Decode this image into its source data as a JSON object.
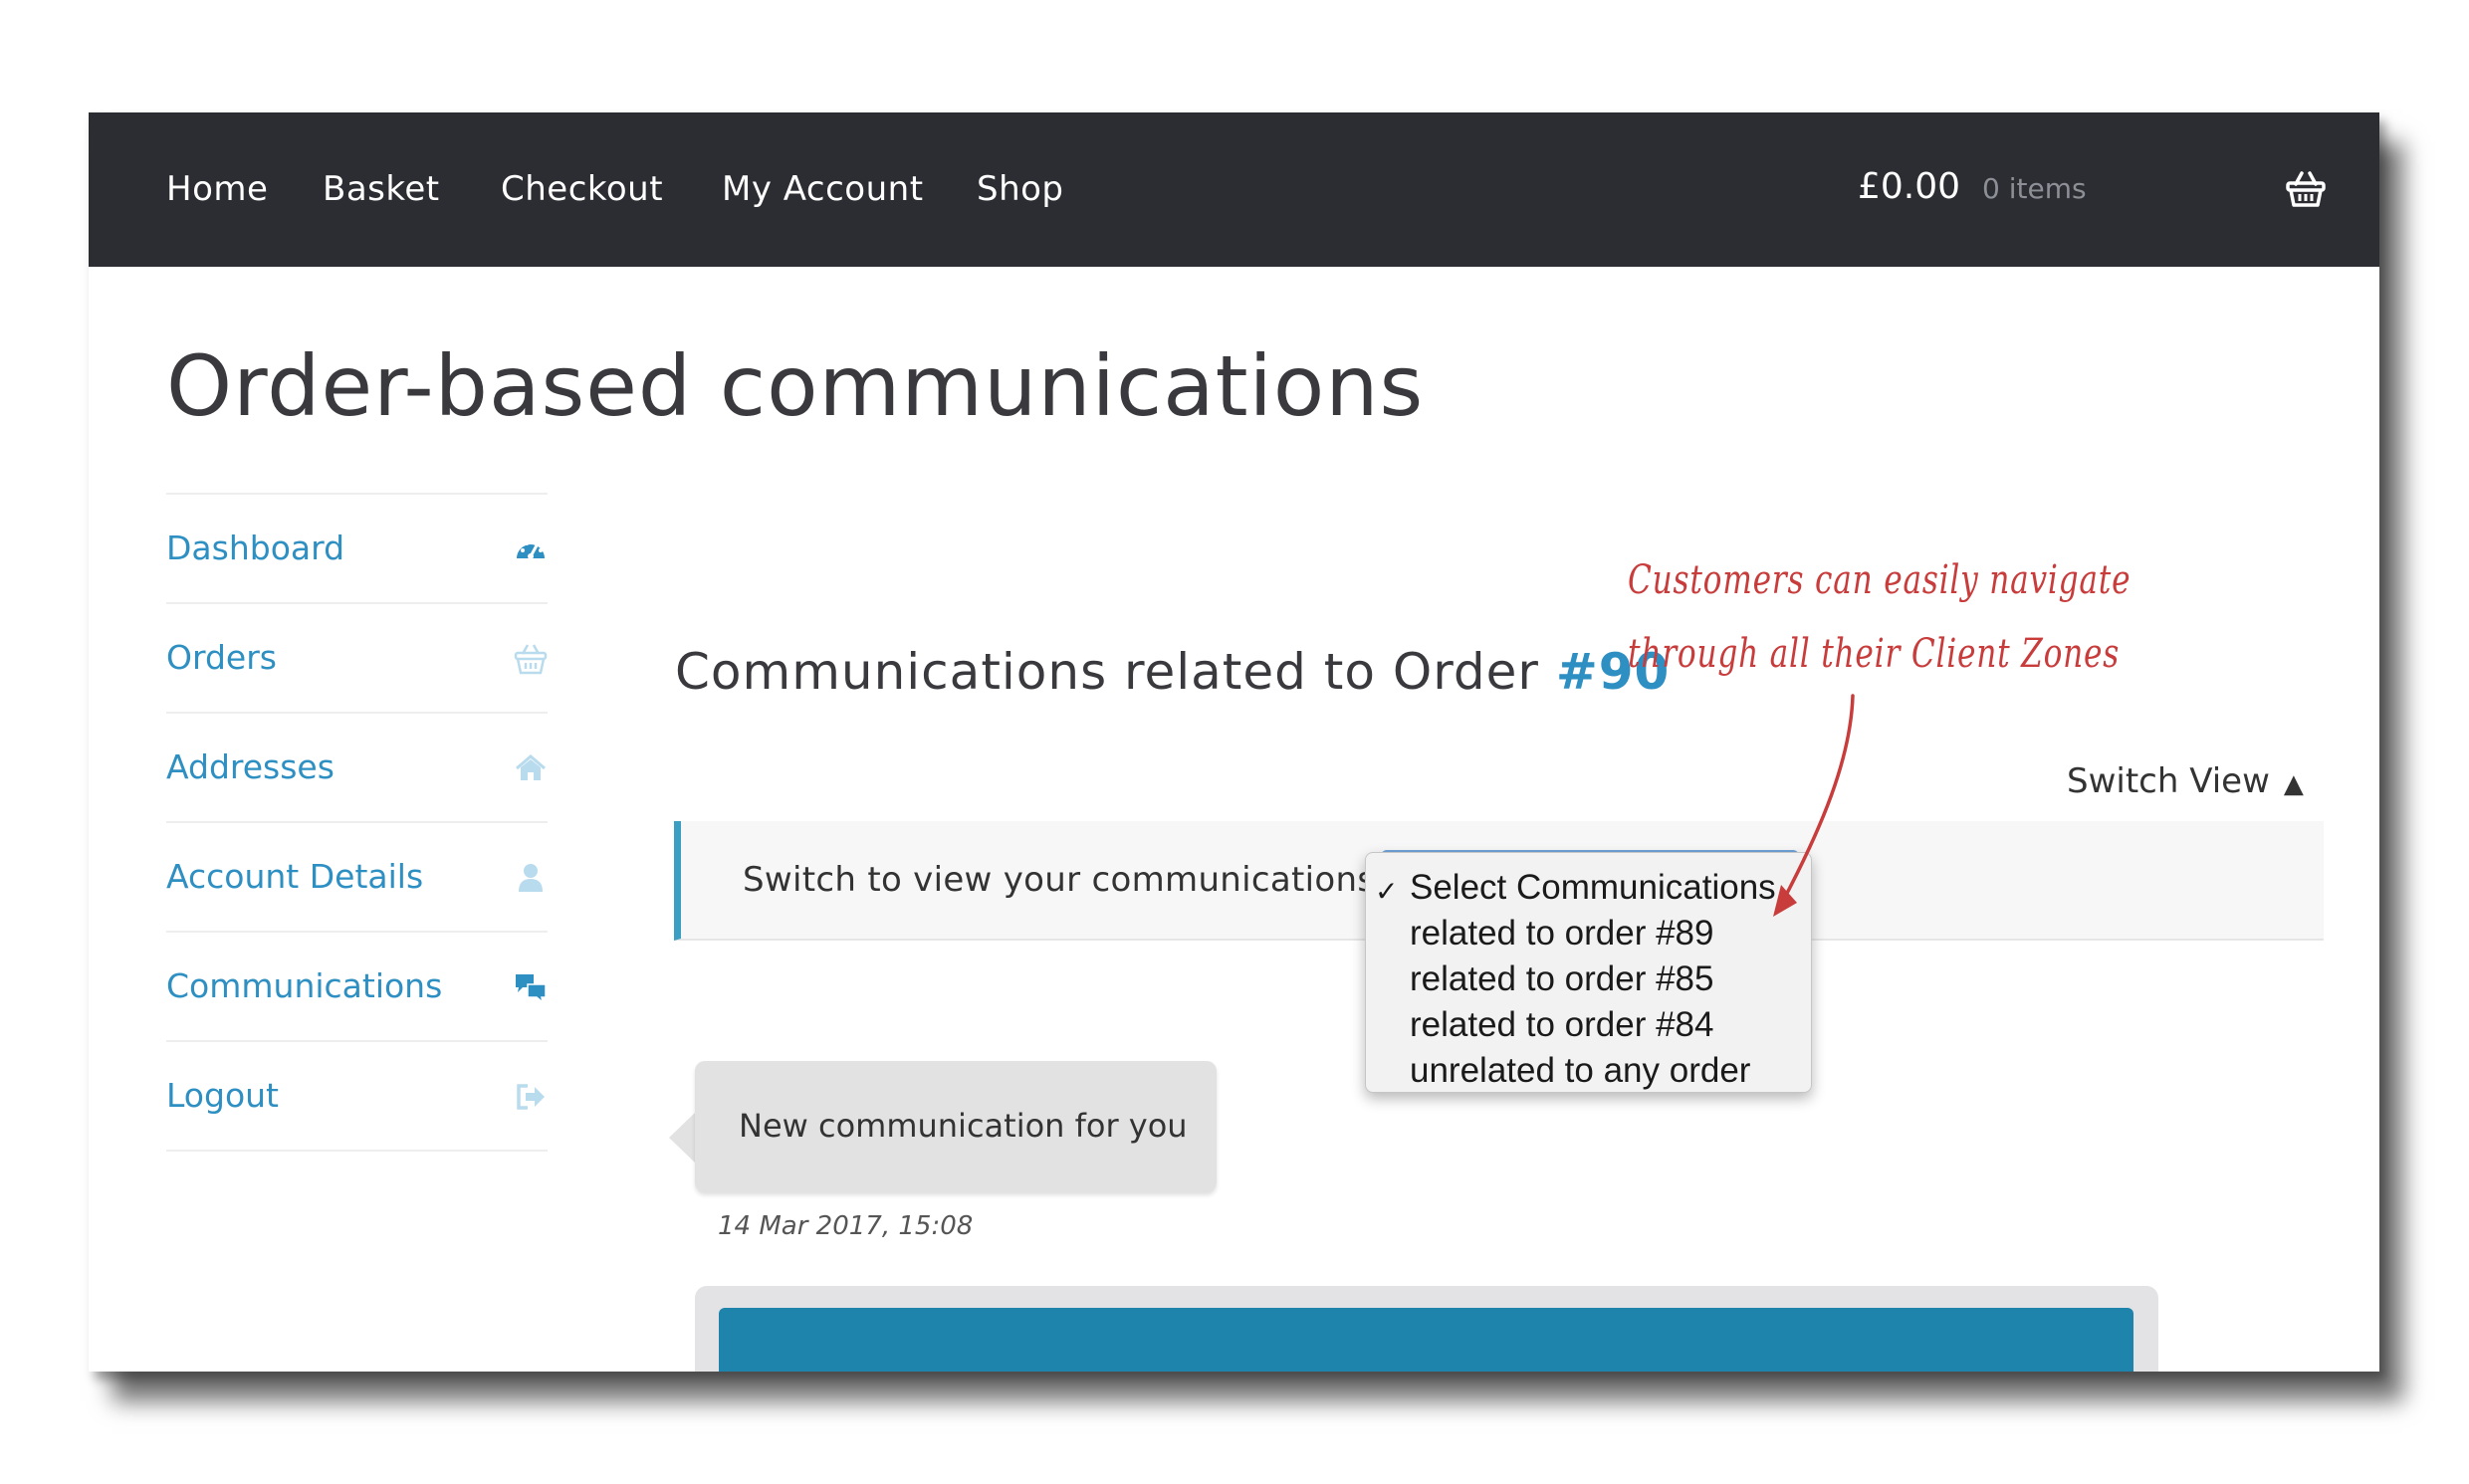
{
  "nav": {
    "items": [
      "Home",
      "Basket",
      "Checkout",
      "My Account",
      "Shop"
    ],
    "cart_amount": "£0.00",
    "cart_count": "0 items",
    "cart_icon": "basket-icon"
  },
  "page": {
    "title": "Order-based communications"
  },
  "sidebar": {
    "items": [
      {
        "label": "Dashboard",
        "icon": "dashboard-icon"
      },
      {
        "label": "Orders",
        "icon": "basket-icon"
      },
      {
        "label": "Addresses",
        "icon": "home-icon"
      },
      {
        "label": "Account Details",
        "icon": "user-icon"
      },
      {
        "label": "Communications",
        "icon": "chat-icon"
      },
      {
        "label": "Logout",
        "icon": "logout-icon"
      }
    ]
  },
  "main": {
    "heading_prefix": "Communications related to Order",
    "order_number": "#90",
    "switch_view_label": "Switch View",
    "switch_view_arrow": "▲",
    "switch_label": "Switch to view your communications",
    "dropdown": {
      "selected": "Select Communications",
      "checkmark": "✓",
      "options": [
        "Select Communications",
        "related to order #89",
        "related to order #85",
        "related to order #84",
        "unrelated to any order"
      ]
    },
    "message": {
      "text": "New communication for you",
      "timestamp": "14 Mar 2017, 15:08"
    }
  },
  "annotation": {
    "line1": "Customers can easily navigate",
    "line2": "through all their Client Zones"
  },
  "colors": {
    "header_bg": "#2c2d33",
    "link_blue": "#2e8fc3",
    "panel_accent": "#3a9fc2",
    "annotation_red": "#c83c3c",
    "bottom_block": "#1e84ac"
  }
}
